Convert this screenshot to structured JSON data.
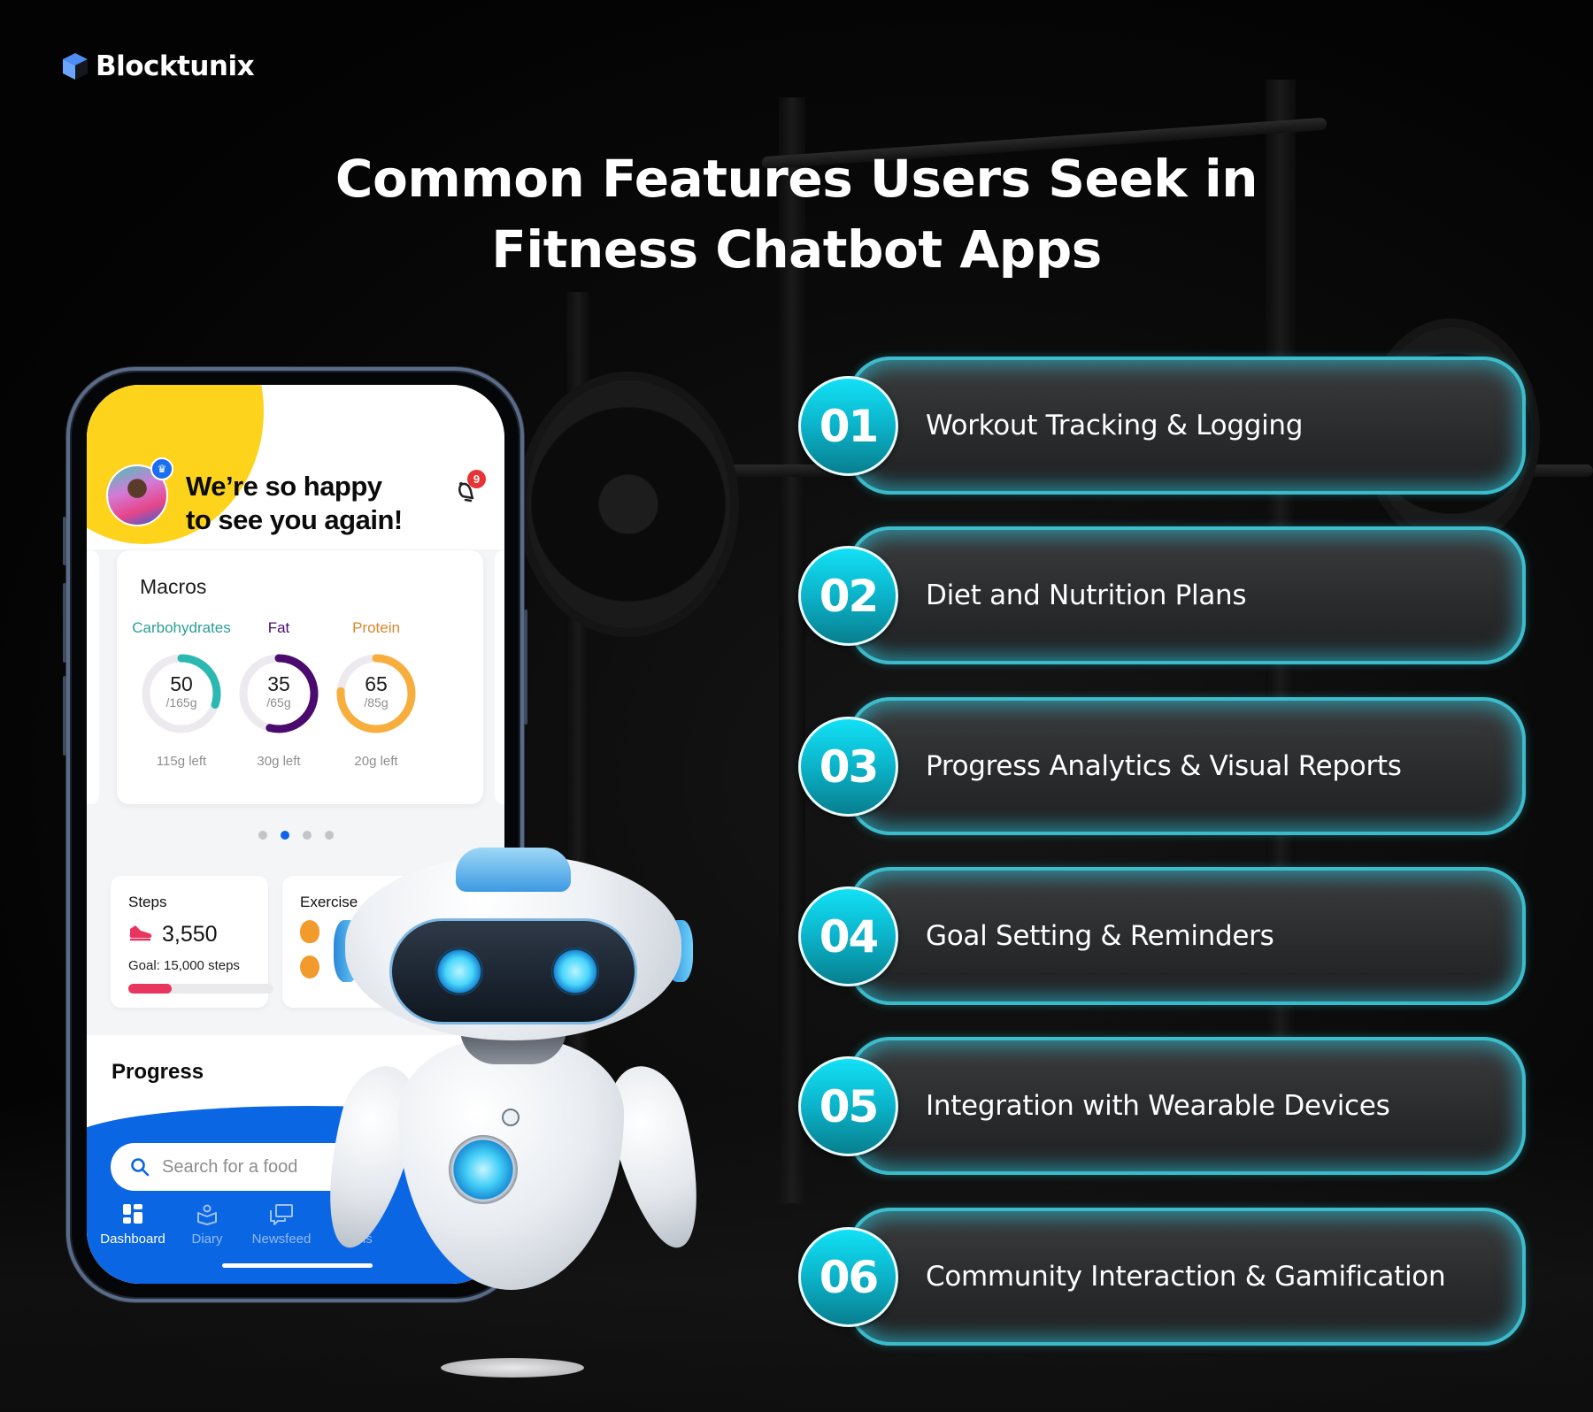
{
  "brand": {
    "name": "Blocktunix",
    "icon": "cube-logo-icon"
  },
  "title": {
    "line1": "Common Features Users Seek in",
    "line2": "Fitness Chatbot Apps"
  },
  "colors": {
    "accent_teal": "#12e1f6",
    "card_glow": "#2eaabe",
    "app_blue": "#0b66e4",
    "carbs": "#2bb8b0",
    "fat": "#4a0a6e",
    "protein": "#f7ae3c",
    "steps": "#e83560"
  },
  "features": [
    {
      "number": "01",
      "label": "Workout Tracking & Logging"
    },
    {
      "number": "02",
      "label": "Diet and Nutrition Plans"
    },
    {
      "number": "03",
      "label": "Progress Analytics & Visual Reports"
    },
    {
      "number": "04",
      "label": "Goal Setting & Reminders"
    },
    {
      "number": "05",
      "label": "Integration with Wearable Devices"
    },
    {
      "number": "06",
      "label": "Community Interaction & Gamification"
    }
  ],
  "phone": {
    "greeting_line1": "We’re so happy",
    "greeting_line2": "to see you again!",
    "notification_count": "9",
    "avatar_badge_icon": "crown-icon",
    "macros": {
      "title": "Macros",
      "items": [
        {
          "name": "Carbohydrates",
          "value": "50",
          "max": "/165g",
          "left": "115g left",
          "fraction": 0.3,
          "color": "#2bb8b0"
        },
        {
          "name": "Fat",
          "value": "35",
          "max": "/65g",
          "left": "30g left",
          "fraction": 0.54,
          "color": "#4a0a6e"
        },
        {
          "name": "Protein",
          "value": "65",
          "max": "/85g",
          "left": "20g left",
          "fraction": 0.76,
          "color": "#f7ae3c"
        }
      ]
    },
    "carousel": {
      "count": 4,
      "active": 1
    },
    "steps": {
      "title": "Steps",
      "value": "3,550",
      "goal": "Goal: 15,000 steps",
      "fraction": 0.3
    },
    "exercise": {
      "title": "Exercise"
    },
    "progress_title": "Progress",
    "search": {
      "placeholder": "Search for a food"
    },
    "nav": [
      {
        "label": "Dashboard",
        "icon": "dashboard-icon",
        "active": true
      },
      {
        "label": "Diary",
        "icon": "diary-icon",
        "active": false
      },
      {
        "label": "Newsfeed",
        "icon": "newsfeed-icon",
        "active": false
      },
      {
        "label": "Plans",
        "icon": "plans-icon",
        "active": false
      }
    ]
  }
}
